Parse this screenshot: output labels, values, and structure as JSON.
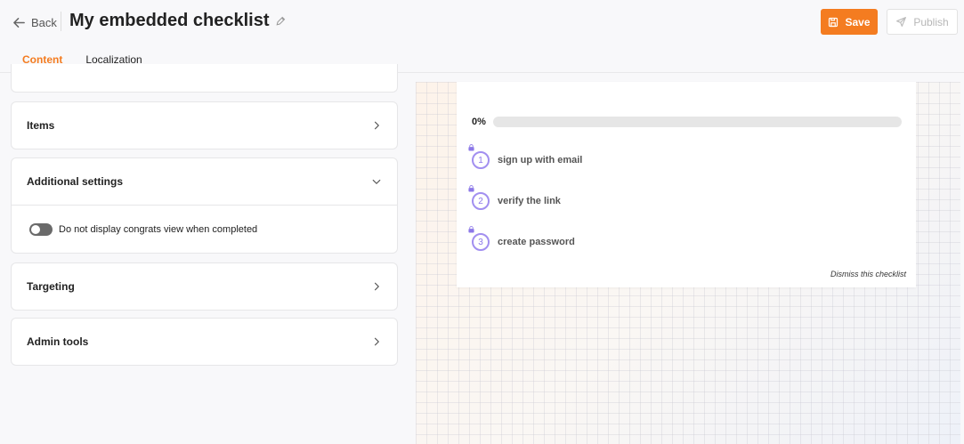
{
  "header": {
    "back_label": "Back",
    "title": "My embedded checklist",
    "save_label": "Save",
    "publish_label": "Publish",
    "accent_color": "#f47c20"
  },
  "tabs": [
    {
      "label": "Content",
      "active": true
    },
    {
      "label": "Localization",
      "active": false
    }
  ],
  "panels": {
    "items": {
      "label": "Items",
      "icon": "chevron-right-icon"
    },
    "additional_settings": {
      "label": "Additional settings",
      "icon": "chevron-down-icon",
      "toggle_label": "Do not display congrats view when completed",
      "toggle_on": false
    },
    "targeting": {
      "label": "Targeting",
      "icon": "chevron-right-icon"
    },
    "admin_tools": {
      "label": "Admin tools",
      "icon": "chevron-right-icon"
    }
  },
  "checklist": {
    "progress_text": "0%",
    "progress_value": 0,
    "progress_color": "#8c78e8",
    "items": [
      {
        "number": "1",
        "label": "sign up with email",
        "locked": true
      },
      {
        "number": "2",
        "label": "verify the link",
        "locked": true
      },
      {
        "number": "3",
        "label": "create password",
        "locked": true
      }
    ],
    "dismiss_label": "Dismiss this checklist"
  }
}
